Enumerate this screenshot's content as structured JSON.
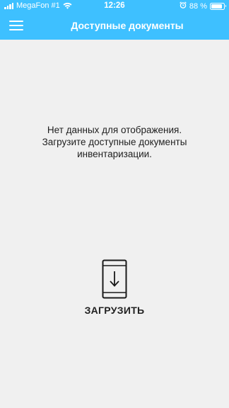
{
  "status_bar": {
    "carrier": "MegaFon #1",
    "time": "12:26",
    "battery_text": "88 %",
    "battery_level": 0.88
  },
  "header": {
    "title": "Доступные документы",
    "background_color": "#3ec0ff"
  },
  "empty_state": {
    "message_lines": [
      "Нет данных для отображения.",
      "Загрузите доступные документы",
      "инвентаризации."
    ]
  },
  "upload": {
    "label": "ЗАГРУЗИТЬ",
    "icon": "phone-download-icon"
  }
}
